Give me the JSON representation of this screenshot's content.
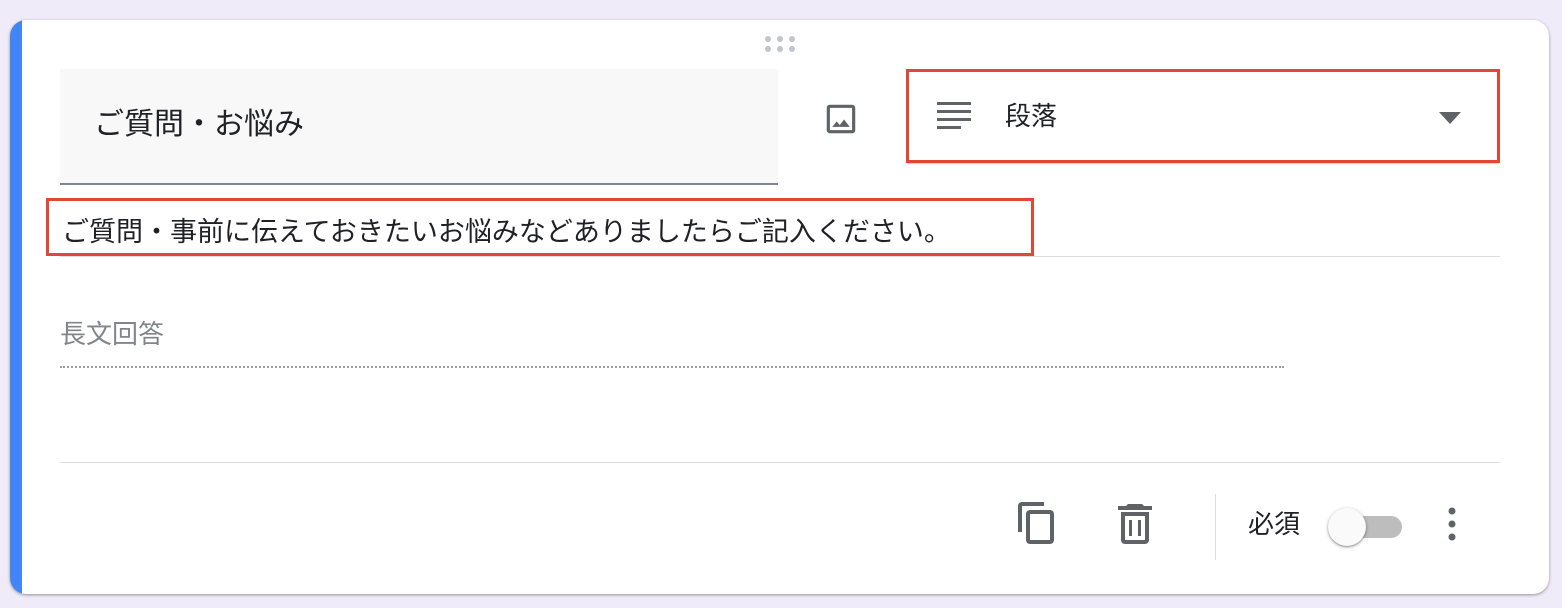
{
  "question": {
    "title": "ご質問・お悩み",
    "description": "ご質問・事前に伝えておきたいお悩みなどありましたらご記入ください。",
    "answer_placeholder": "長文回答"
  },
  "type_selector": {
    "selected_label": "段落",
    "icon": "paragraph-lines-icon"
  },
  "footer": {
    "required_label": "必須",
    "required_on": false
  },
  "colors": {
    "accent": "#4285f4",
    "highlight": "#e24634"
  },
  "icons": [
    "drag-handle-icon",
    "image-icon",
    "paragraph-lines-icon",
    "dropdown-caret-icon",
    "copy-icon",
    "trash-icon",
    "more-vert-icon"
  ]
}
